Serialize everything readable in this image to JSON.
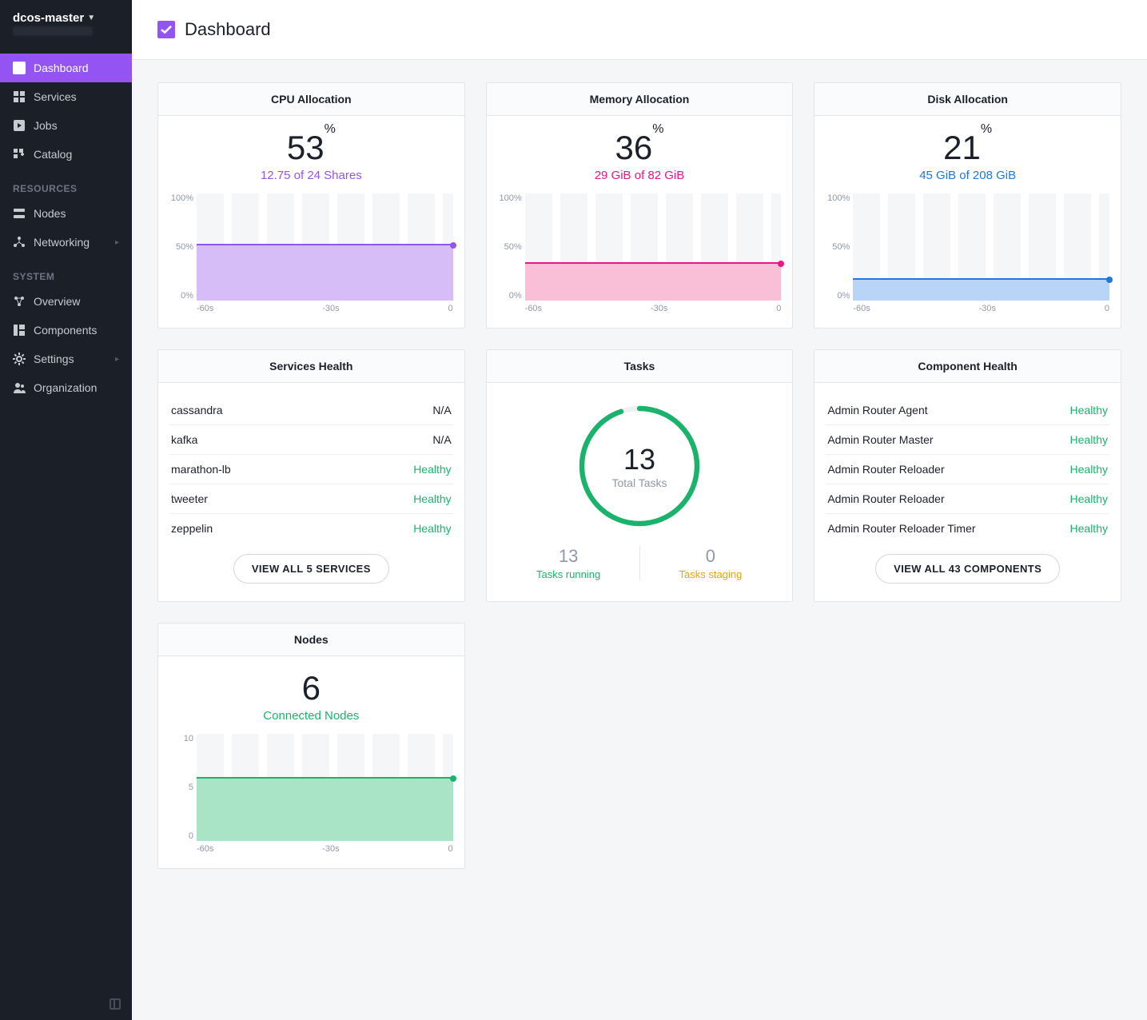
{
  "cluster": {
    "name": "dcos-master"
  },
  "page": {
    "title": "Dashboard"
  },
  "sidebar": {
    "primary": [
      {
        "label": "Dashboard"
      },
      {
        "label": "Services"
      },
      {
        "label": "Jobs"
      },
      {
        "label": "Catalog"
      }
    ],
    "resources_label": "RESOURCES",
    "resources": [
      {
        "label": "Nodes"
      },
      {
        "label": "Networking"
      }
    ],
    "system_label": "SYSTEM",
    "system": [
      {
        "label": "Overview"
      },
      {
        "label": "Components"
      },
      {
        "label": "Settings"
      },
      {
        "label": "Organization"
      }
    ]
  },
  "cpu": {
    "title": "CPU Allocation",
    "percent": "53",
    "detail": "12.75 of 24 Shares"
  },
  "memory": {
    "title": "Memory Allocation",
    "percent": "36",
    "detail": "29 GiB of 82 GiB"
  },
  "disk": {
    "title": "Disk Allocation",
    "percent": "21",
    "detail": "45 GiB of 208 GiB"
  },
  "axis": {
    "y100": "100%",
    "y50": "50%",
    "y0": "0%",
    "x0": "-60s",
    "x1": "-30s",
    "x2": "0"
  },
  "services": {
    "title": "Services Health",
    "items": [
      {
        "name": "cassandra",
        "status": "N/A",
        "healthy": false
      },
      {
        "name": "kafka",
        "status": "N/A",
        "healthy": false
      },
      {
        "name": "marathon-lb",
        "status": "Healthy",
        "healthy": true
      },
      {
        "name": "tweeter",
        "status": "Healthy",
        "healthy": true
      },
      {
        "name": "zeppelin",
        "status": "Healthy",
        "healthy": true
      }
    ],
    "view_all": "VIEW ALL 5 SERVICES"
  },
  "tasks": {
    "title": "Tasks",
    "total": "13",
    "total_label": "Total Tasks",
    "running": "13",
    "running_label": "Tasks running",
    "staging": "0",
    "staging_label": "Tasks staging"
  },
  "components": {
    "title": "Component Health",
    "items": [
      {
        "name": "Admin Router Agent",
        "status": "Healthy"
      },
      {
        "name": "Admin Router Master",
        "status": "Healthy"
      },
      {
        "name": "Admin Router Reloader",
        "status": "Healthy"
      },
      {
        "name": "Admin Router Reloader",
        "status": "Healthy"
      },
      {
        "name": "Admin Router Reloader Timer",
        "status": "Healthy"
      }
    ],
    "view_all": "VIEW ALL 43 COMPONENTS"
  },
  "nodes": {
    "title": "Nodes",
    "count": "6",
    "label": "Connected Nodes",
    "ymax": "10",
    "ymid": "5",
    "ymin": "0"
  },
  "chart_data": [
    {
      "type": "area",
      "title": "CPU Allocation",
      "x": [
        "-60s",
        "-30s",
        "0"
      ],
      "values": [
        53,
        53,
        53
      ],
      "ylim": [
        0,
        100
      ],
      "ylabel": "%",
      "color": "#9454f4"
    },
    {
      "type": "area",
      "title": "Memory Allocation",
      "x": [
        "-60s",
        "-30s",
        "0"
      ],
      "values": [
        36,
        36,
        36
      ],
      "ylim": [
        0,
        100
      ],
      "ylabel": "%",
      "color": "#ec1581"
    },
    {
      "type": "area",
      "title": "Disk Allocation",
      "x": [
        "-60s",
        "-30s",
        "0"
      ],
      "values": [
        21,
        21,
        21
      ],
      "ylim": [
        0,
        100
      ],
      "ylabel": "%",
      "color": "#2276e0"
    },
    {
      "type": "area",
      "title": "Nodes",
      "x": [
        "-60s",
        "-30s",
        "0"
      ],
      "values": [
        6,
        6,
        6
      ],
      "ylim": [
        0,
        10
      ],
      "ylabel": "count",
      "color": "#1bb36c"
    },
    {
      "type": "pie",
      "title": "Tasks",
      "series": [
        {
          "name": "Tasks running",
          "value": 13
        },
        {
          "name": "Tasks staging",
          "value": 0
        }
      ]
    }
  ]
}
